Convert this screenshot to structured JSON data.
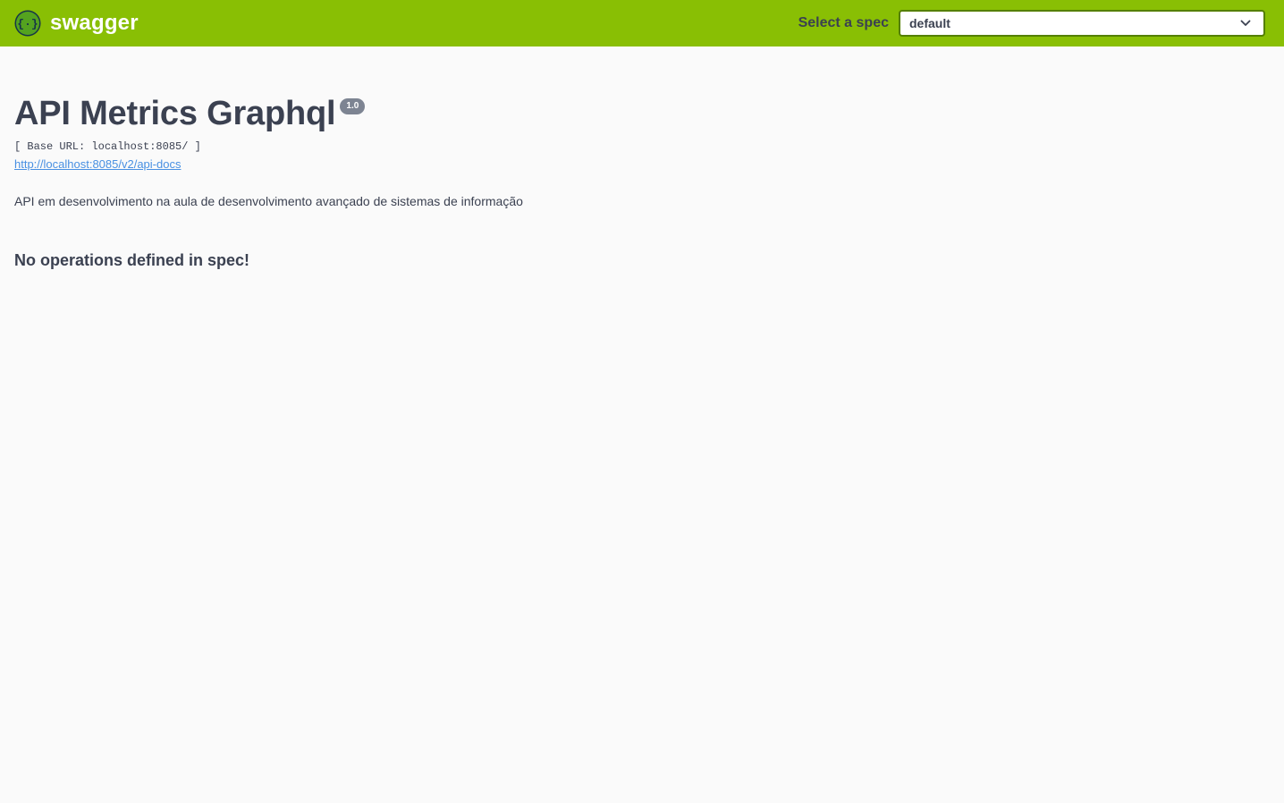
{
  "topbar": {
    "brand_name": "swagger",
    "logo_icon": "swagger-braces-logo-icon",
    "spec_label": "Select a spec",
    "spec_selected": "default",
    "background_color": "#89bf04",
    "select_border_color": "#547f00"
  },
  "info": {
    "title": "API Metrics Graphql",
    "version": "1.0",
    "base_url": "[ Base URL: localhost:8085/ ]",
    "docs_link": "http://localhost:8085/v2/api-docs",
    "description": "API em desenvolvimento na aula de desenvolvimento avançado de sistemas de informação",
    "link_color": "#4990e2",
    "text_color": "#3b4151"
  },
  "operations": {
    "empty_message": "No operations defined in spec!"
  }
}
